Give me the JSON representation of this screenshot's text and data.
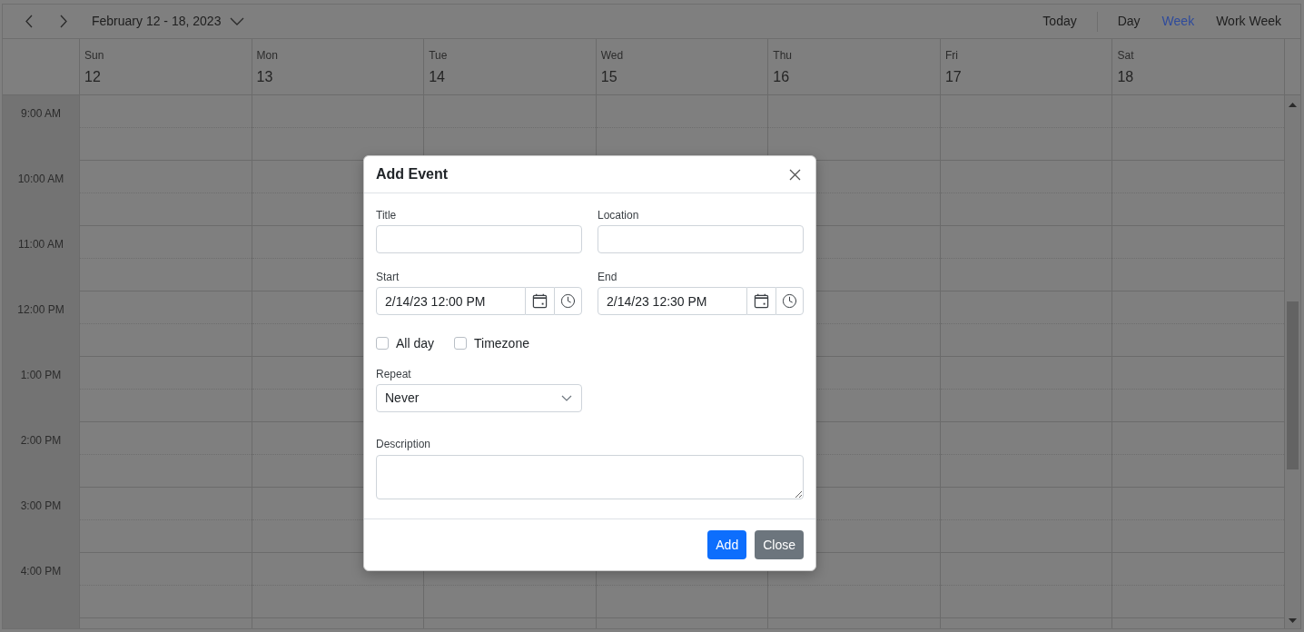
{
  "toolbar": {
    "date_range": "February 12 - 18, 2023",
    "today": "Today",
    "views": [
      {
        "label": "Day",
        "selected": false
      },
      {
        "label": "Week",
        "selected": true
      },
      {
        "label": "Work Week",
        "selected": false
      }
    ]
  },
  "days": [
    {
      "weekday": "Sun",
      "date": "12"
    },
    {
      "weekday": "Mon",
      "date": "13"
    },
    {
      "weekday": "Tue",
      "date": "14"
    },
    {
      "weekday": "Wed",
      "date": "15"
    },
    {
      "weekday": "Thu",
      "date": "16"
    },
    {
      "weekday": "Fri",
      "date": "17"
    },
    {
      "weekday": "Sat",
      "date": "18"
    }
  ],
  "time_slots": [
    "9:00 AM",
    "10:00 AM",
    "11:00 AM",
    "12:00 PM",
    "1:00 PM",
    "2:00 PM",
    "3:00 PM",
    "4:00 PM"
  ],
  "dialog": {
    "title": "Add Event",
    "fields": [
      {
        "kind": "text",
        "label": "Title"
      },
      {
        "kind": "text",
        "label": "Location"
      },
      {
        "kind": "datetime",
        "label": "Start",
        "value": "2/14/23 12:00 PM"
      },
      {
        "kind": "datetime",
        "label": "End",
        "value": "2/14/23 12:30 PM"
      }
    ],
    "options": [
      {
        "label": "All day",
        "checked": false
      },
      {
        "label": "Timezone",
        "checked": false
      }
    ],
    "repeat": {
      "label": "Repeat",
      "value": "Never"
    },
    "description": {
      "label": "Description"
    },
    "buttons": [
      {
        "label": "Add",
        "kind": "primary"
      },
      {
        "label": "Close",
        "kind": "secondary"
      }
    ]
  }
}
